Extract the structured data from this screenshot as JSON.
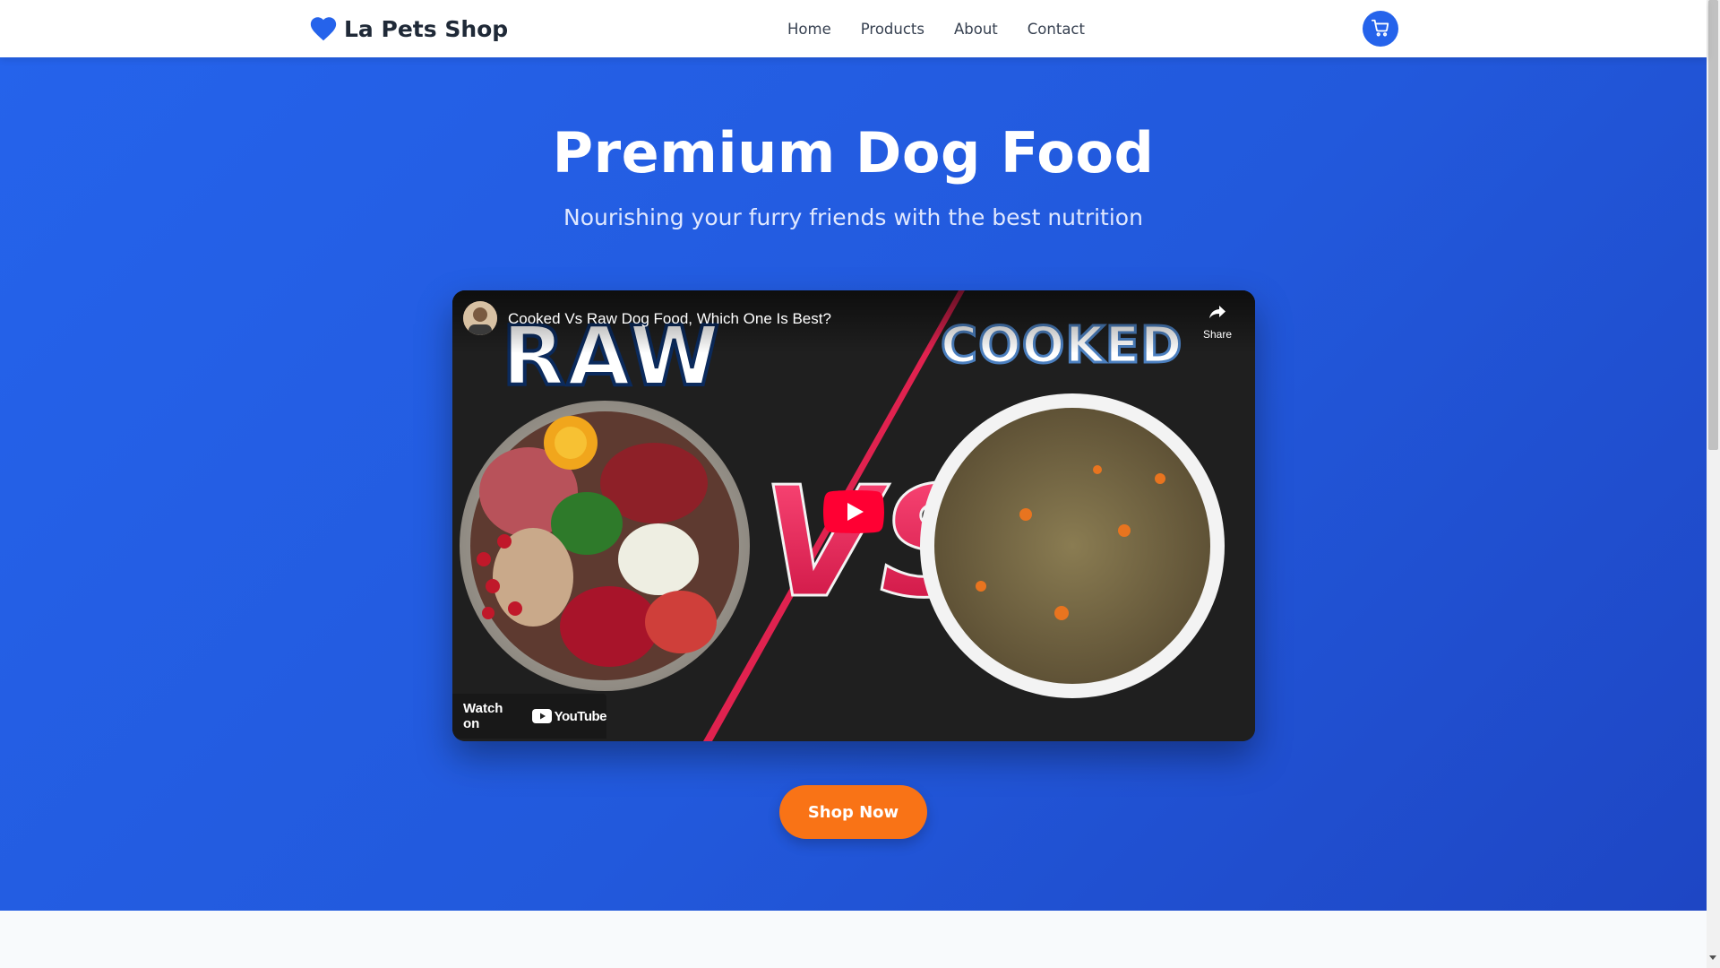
{
  "header": {
    "logo_text": "La Pets Shop",
    "logo_icon": "heart-icon",
    "nav": [
      "Home",
      "Products",
      "About",
      "Contact"
    ],
    "cart_icon": "shopping-cart-icon"
  },
  "hero": {
    "title": "Premium Dog Food",
    "subtitle": "Nourishing your furry friends with the best nutrition"
  },
  "video": {
    "title": "Cooked Vs Raw Dog Food, Which One Is Best?",
    "thumbnail_text_left": "RAW",
    "thumbnail_text_right": "COOKED",
    "thumbnail_text_center": "VS",
    "share_label": "Share",
    "watch_on_label": "Watch on",
    "youtube_label": "YouTube"
  },
  "cta": {
    "label": "Shop Now"
  },
  "colors": {
    "primary": "#2563eb",
    "accent": "#f97316",
    "hero_gradient_end": "#1e46c4"
  }
}
